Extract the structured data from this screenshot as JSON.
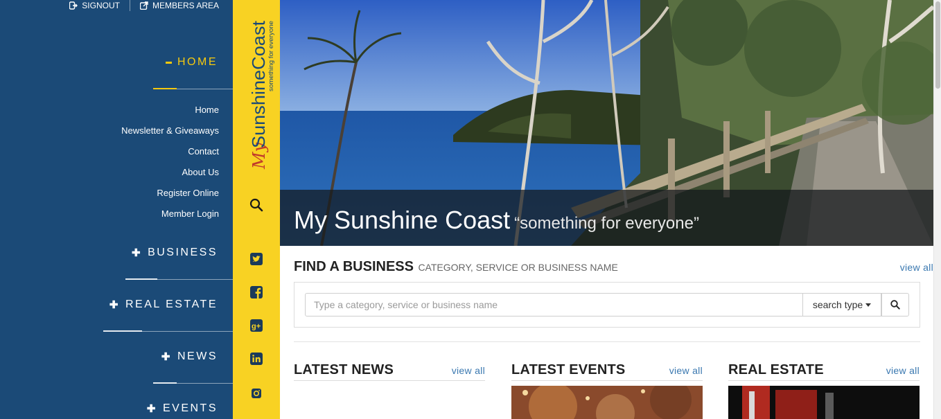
{
  "toplinks": {
    "signout": "SIGNOUT",
    "members": "MEMBERS AREA"
  },
  "sidebar": {
    "home_title": "HOME",
    "menu": [
      "Home",
      "Newsletter & Giveaways",
      "Contact",
      "About Us",
      "Register Online",
      "Member Login"
    ],
    "sections": [
      "BUSINESS",
      "REAL ESTATE",
      "NEWS",
      "EVENTS"
    ]
  },
  "logo": {
    "my": "My",
    "name": "SunshineCoast",
    "tagline": "something for everyone"
  },
  "hero": {
    "title": "My Sunshine Coast",
    "tagline": "“something for everyone”"
  },
  "find": {
    "title": "FIND A BUSINESS",
    "subtitle": "CATEGORY, SERVICE OR BUSINESS NAME",
    "view_all": "view all",
    "placeholder": "Type a category, service or business name",
    "search_type": "search type"
  },
  "columns": [
    {
      "title": "LATEST NEWS",
      "view_all": "view all"
    },
    {
      "title": "LATEST EVENTS",
      "view_all": "view all"
    },
    {
      "title": "REAL ESTATE",
      "view_all": "view all"
    }
  ],
  "strip_icons": [
    "search-icon",
    "twitter-icon",
    "facebook-icon",
    "google-plus-icon",
    "linkedin-icon",
    "instagram-icon"
  ],
  "colors": {
    "sidebar": "#1b4a77",
    "strip": "#f8d223",
    "accent": "#f6c90e",
    "link": "#3a78b0"
  }
}
